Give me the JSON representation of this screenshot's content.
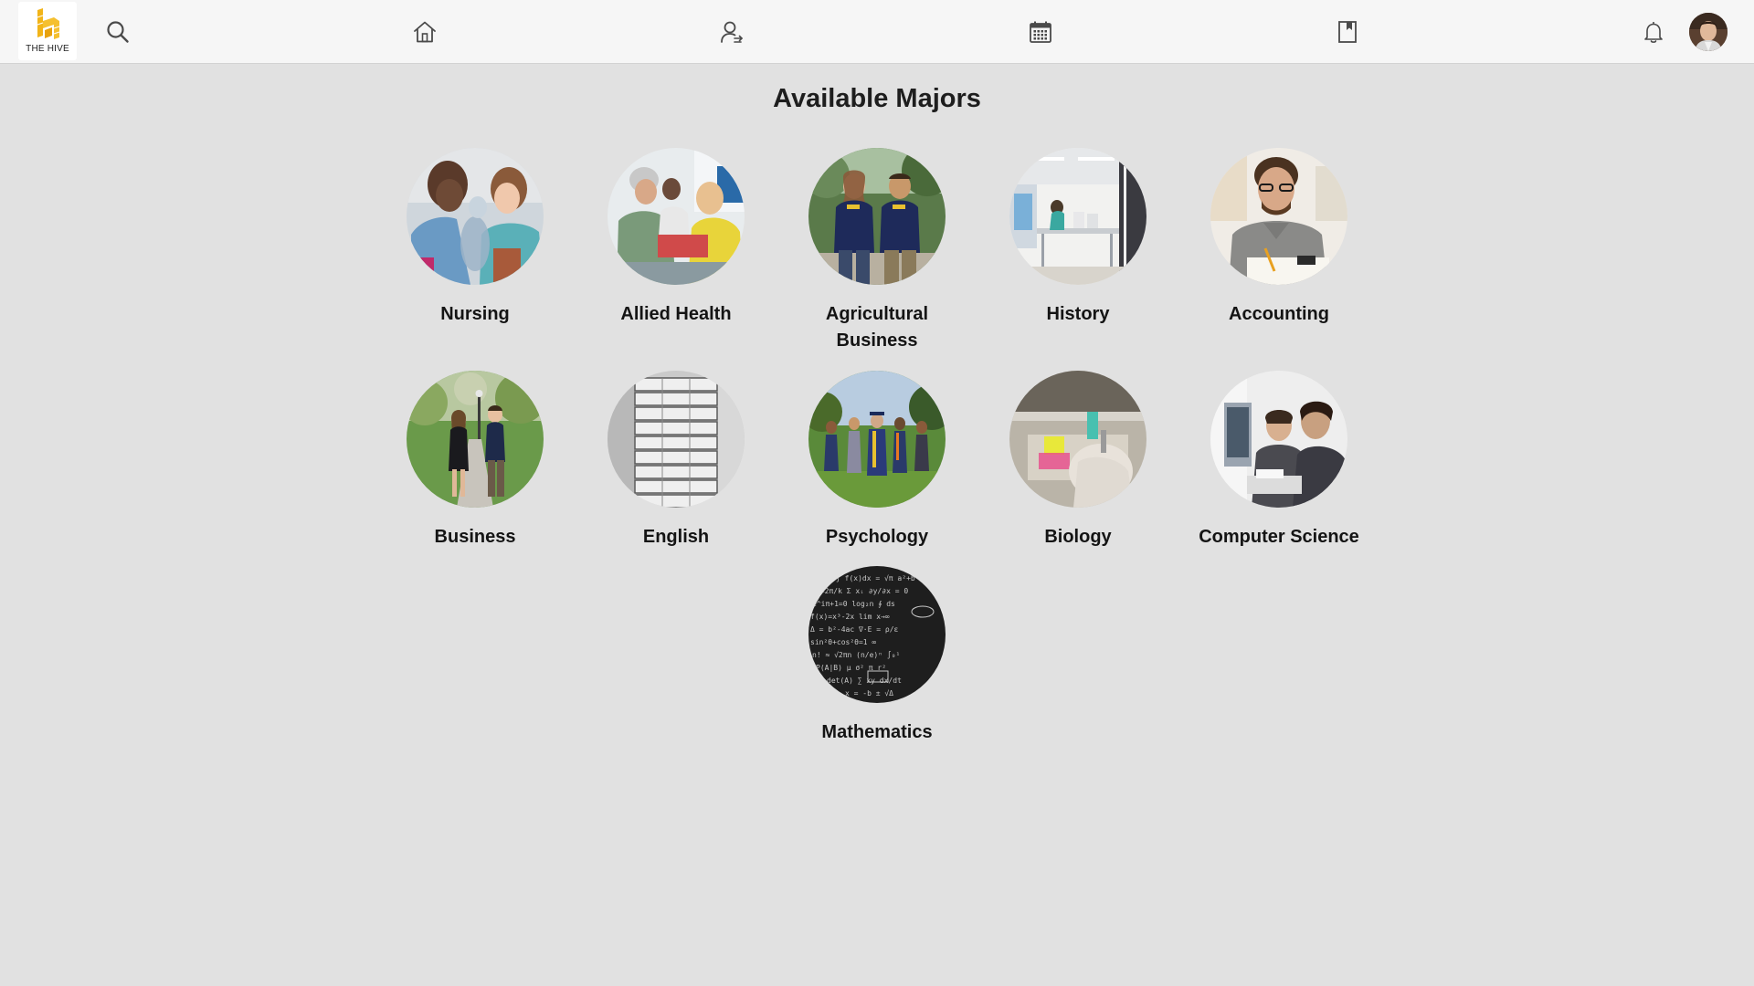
{
  "app": {
    "logo_text": "THE HIVE",
    "accent_color": "#f2b418"
  },
  "nav": {
    "items": [
      {
        "name": "search-icon"
      },
      {
        "name": "home-icon"
      },
      {
        "name": "user-connect-icon"
      },
      {
        "name": "calendar-icon"
      },
      {
        "name": "bookmark-icon"
      },
      {
        "name": "bell-icon"
      }
    ]
  },
  "page": {
    "title": "Available Majors"
  },
  "majors": [
    {
      "label": "Nursing"
    },
    {
      "label": "Allied Health"
    },
    {
      "label": "Agricultural Business"
    },
    {
      "label": "History"
    },
    {
      "label": "Accounting"
    },
    {
      "label": "Business"
    },
    {
      "label": "English"
    },
    {
      "label": "Psychology"
    },
    {
      "label": "Biology"
    },
    {
      "label": "Computer Science"
    },
    {
      "label": "Mathematics"
    }
  ]
}
